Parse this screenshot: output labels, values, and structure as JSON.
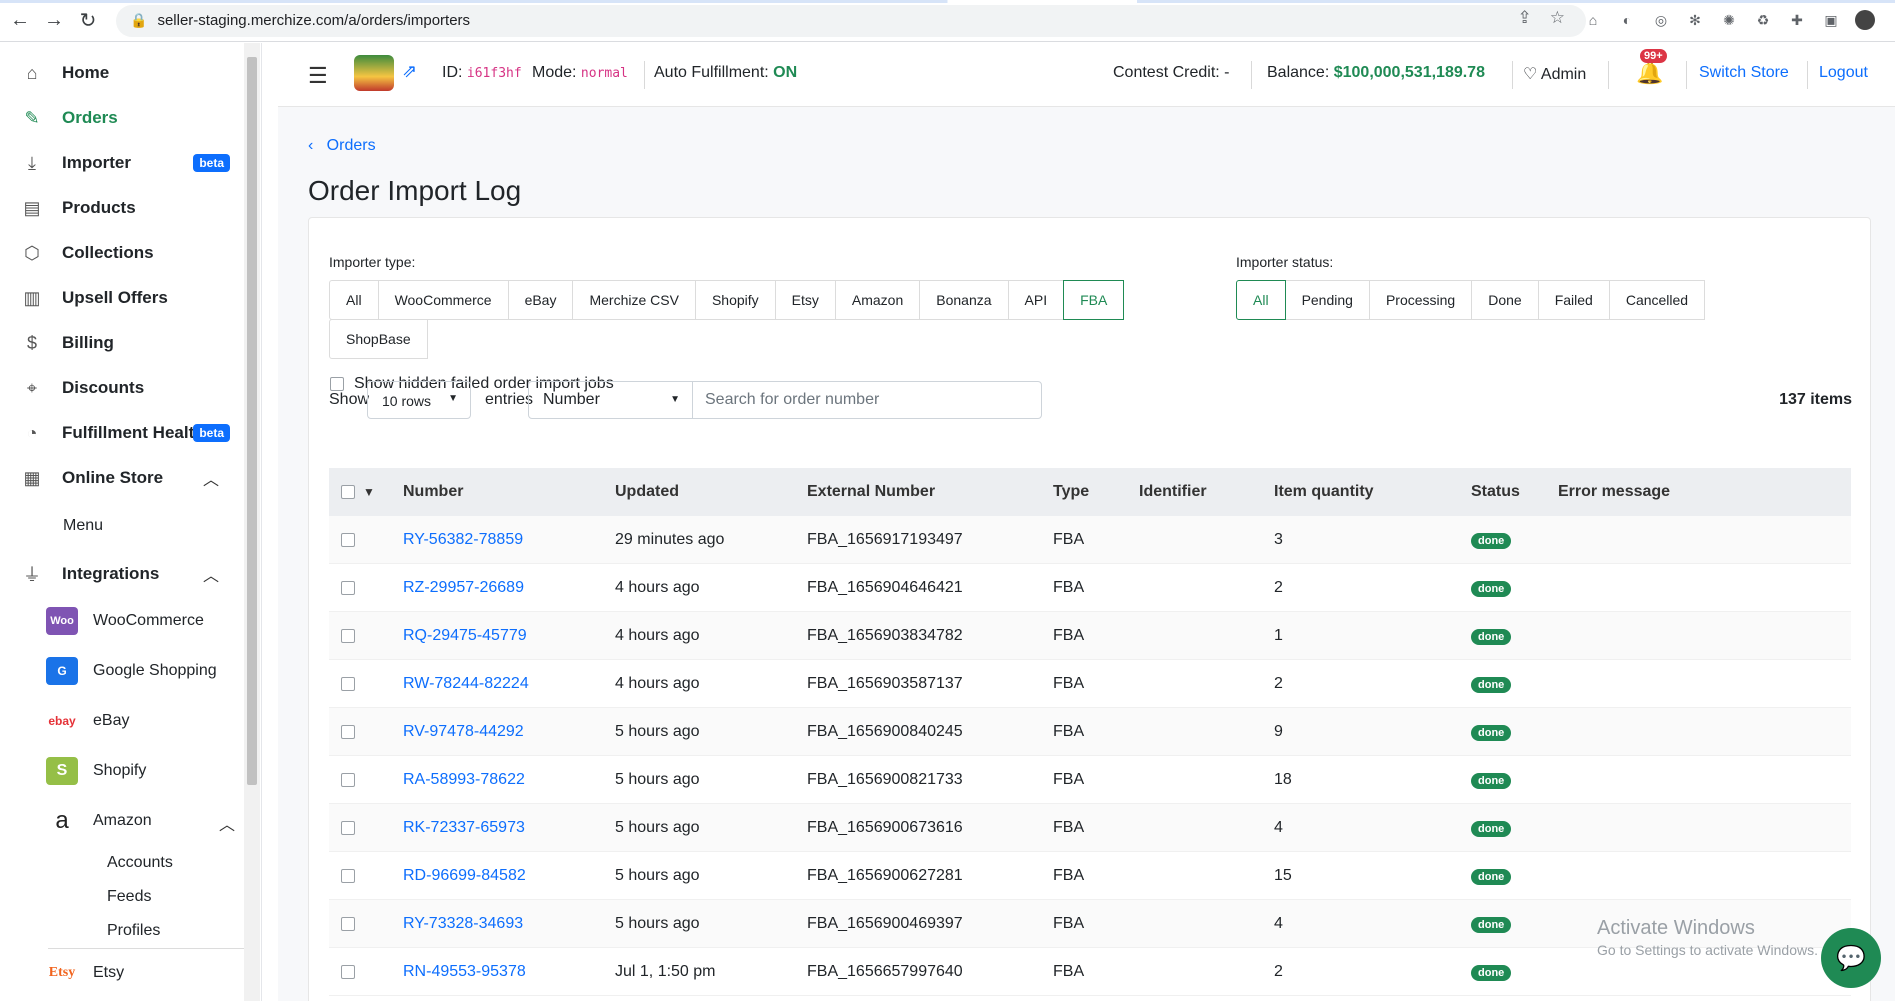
{
  "browser": {
    "url": "seller-staging.merchize.com/a/orders/importers"
  },
  "sidebar": {
    "items": [
      {
        "label": "Home",
        "icon": "home-icon"
      },
      {
        "label": "Orders",
        "icon": "edit-icon",
        "active": true
      },
      {
        "label": "Importer",
        "icon": "download-icon",
        "badge": "beta"
      },
      {
        "label": "Products",
        "icon": "archive-icon"
      },
      {
        "label": "Collections",
        "icon": "box-icon"
      },
      {
        "label": "Upsell Offers",
        "icon": "book-icon"
      },
      {
        "label": "Billing",
        "icon": "dollar-icon"
      },
      {
        "label": "Discounts",
        "icon": "tag-icon"
      },
      {
        "label": "Fulfillment Health",
        "icon": "pie-icon",
        "badge": "beta"
      },
      {
        "label": "Online Store",
        "icon": "store-icon"
      }
    ],
    "online_store_sub": [
      "Menu"
    ],
    "integrations_label": "Integrations",
    "integrations": [
      {
        "label": "WooCommerce",
        "logo": "Woo"
      },
      {
        "label": "Google Shopping",
        "logo": "G"
      },
      {
        "label": "eBay",
        "logo": "ebay"
      },
      {
        "label": "Shopify",
        "logo": "S"
      },
      {
        "label": "Amazon",
        "logo": "a"
      }
    ],
    "amazon_sub": [
      "Accounts",
      "Feeds",
      "Profiles"
    ],
    "etsy": {
      "label": "Etsy",
      "logo": "Etsy"
    }
  },
  "header": {
    "id_label": "ID:",
    "id_value": "i61f3hf",
    "mode_label": "Mode:",
    "mode_value": "normal",
    "auto_label": "Auto Fulfillment:",
    "auto_value": "ON",
    "contest_label": "Contest Credit:",
    "contest_value": "-",
    "balance_label": "Balance:",
    "balance_value": "$100,000,531,189.78",
    "admin_label": "Admin",
    "notif_badge": "99+",
    "switch_store": "Switch Store",
    "logout": "Logout"
  },
  "page": {
    "breadcrumb": "Orders",
    "title": "Order Import Log"
  },
  "filters": {
    "type_label": "Importer type:",
    "types": [
      "All",
      "WooCommerce",
      "eBay",
      "Merchize CSV",
      "Shopify",
      "Etsy",
      "Amazon",
      "Bonanza",
      "API",
      "FBA"
    ],
    "types_row2": [
      "ShopBase"
    ],
    "type_selected": "FBA",
    "status_label": "Importer status:",
    "statuses": [
      "All",
      "Pending",
      "Processing",
      "Done",
      "Failed",
      "Cancelled"
    ],
    "status_selected": "All",
    "hidden_failed_label": "Show hidden failed order import jobs"
  },
  "controls": {
    "show_label": "Show",
    "rows_value": "10 rows",
    "entries_label": "entries",
    "field_value": "Number",
    "search_placeholder": "Search for order number",
    "items_count": "137 items"
  },
  "table": {
    "headers": [
      "Number",
      "Updated",
      "External Number",
      "Type",
      "Identifier",
      "Item quantity",
      "Status",
      "Error message"
    ],
    "rows": [
      {
        "number": "RY-56382-78859",
        "updated": "29 minutes ago",
        "external": "FBA_1656917193497",
        "type": "FBA",
        "identifier": "",
        "qty": "3",
        "status": "done"
      },
      {
        "number": "RZ-29957-26689",
        "updated": "4 hours ago",
        "external": "FBA_1656904646421",
        "type": "FBA",
        "identifier": "",
        "qty": "2",
        "status": "done"
      },
      {
        "number": "RQ-29475-45779",
        "updated": "4 hours ago",
        "external": "FBA_1656903834782",
        "type": "FBA",
        "identifier": "",
        "qty": "1",
        "status": "done"
      },
      {
        "number": "RW-78244-82224",
        "updated": "4 hours ago",
        "external": "FBA_1656903587137",
        "type": "FBA",
        "identifier": "",
        "qty": "2",
        "status": "done"
      },
      {
        "number": "RV-97478-44292",
        "updated": "5 hours ago",
        "external": "FBA_1656900840245",
        "type": "FBA",
        "identifier": "",
        "qty": "9",
        "status": "done"
      },
      {
        "number": "RA-58993-78622",
        "updated": "5 hours ago",
        "external": "FBA_1656900821733",
        "type": "FBA",
        "identifier": "",
        "qty": "18",
        "status": "done"
      },
      {
        "number": "RK-72337-65973",
        "updated": "5 hours ago",
        "external": "FBA_1656900673616",
        "type": "FBA",
        "identifier": "",
        "qty": "4",
        "status": "done"
      },
      {
        "number": "RD-96699-84582",
        "updated": "5 hours ago",
        "external": "FBA_1656900627281",
        "type": "FBA",
        "identifier": "",
        "qty": "15",
        "status": "done"
      },
      {
        "number": "RY-73328-34693",
        "updated": "5 hours ago",
        "external": "FBA_1656900469397",
        "type": "FBA",
        "identifier": "",
        "qty": "4",
        "status": "done"
      },
      {
        "number": "RN-49553-95378",
        "updated": "Jul 1, 1:50 pm",
        "external": "FBA_1656657997640",
        "type": "FBA",
        "identifier": "",
        "qty": "2",
        "status": "done"
      }
    ]
  },
  "watermark": {
    "line1": "Activate Windows",
    "line2": "Go to Settings to activate Windows."
  },
  "colors": {
    "accent": "#1f8a54",
    "link": "#0d6efd",
    "badge_beta": "#0d6efd",
    "notif": "#dc3545"
  }
}
